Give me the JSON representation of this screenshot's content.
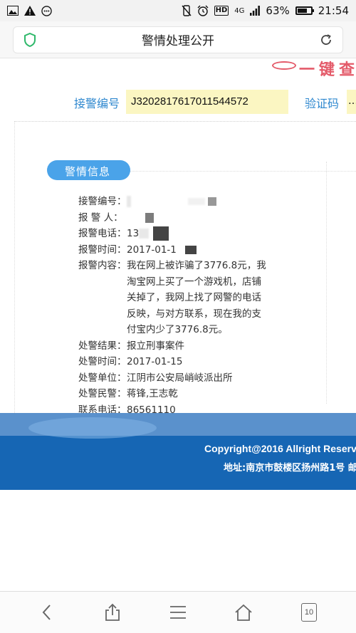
{
  "status_bar": {
    "battery": "63%",
    "battery_level": 0.63,
    "network": "4G",
    "time": "21:54",
    "icons_left": [
      "image-icon",
      "warning-icon",
      "more-icon"
    ],
    "icons_right": [
      "mute-vibrate-icon",
      "alarm-icon",
      "hd-icon",
      "signal-icon",
      "battery-icon"
    ]
  },
  "browser": {
    "page_title": "警情处理公开",
    "secure_icon": "shield-icon",
    "reload_icon": "reload-icon"
  },
  "query": {
    "code_label": "接警编号",
    "code_value": "J3202817617011544572",
    "captcha_label": "验证码",
    "captcha_value": "…"
  },
  "section": {
    "title": "警情信息"
  },
  "info": {
    "rows": [
      {
        "key": "接警编号：",
        "value": ""
      },
      {
        "key": "报 警 人：",
        "value": ""
      },
      {
        "key": "报警电话：",
        "value": "13"
      },
      {
        "key": "报警时间：",
        "value": "2017-01-1"
      },
      {
        "key": "报警内容：",
        "value": "我在网上被诈骗了3776.8元，我淘宝网上买了一个游戏机，店铺关掉了，我网上找了网警的电话反映，与对方联系，现在我的支付宝内少了3776.8元。"
      },
      {
        "key": "处警结果：",
        "value": "报立刑事案件"
      },
      {
        "key": "处警时间：",
        "value": "2017-01-15"
      },
      {
        "key": "处警单位：",
        "value": "江阴市公安局峭岐派出所"
      },
      {
        "key": "处警民警：",
        "value": "蒋锋,王志乾"
      },
      {
        "key": "联系电话：",
        "value": "86561110"
      }
    ]
  },
  "footer": {
    "copyright": "Copyright@2016 Allright Reserv",
    "address": "地址:南京市鼓楼区扬州路1号 邮"
  },
  "nav": {
    "tabs_count": "10",
    "buttons": [
      "back-icon",
      "share-icon",
      "menu-icon",
      "home-icon",
      "tabs-icon"
    ]
  }
}
